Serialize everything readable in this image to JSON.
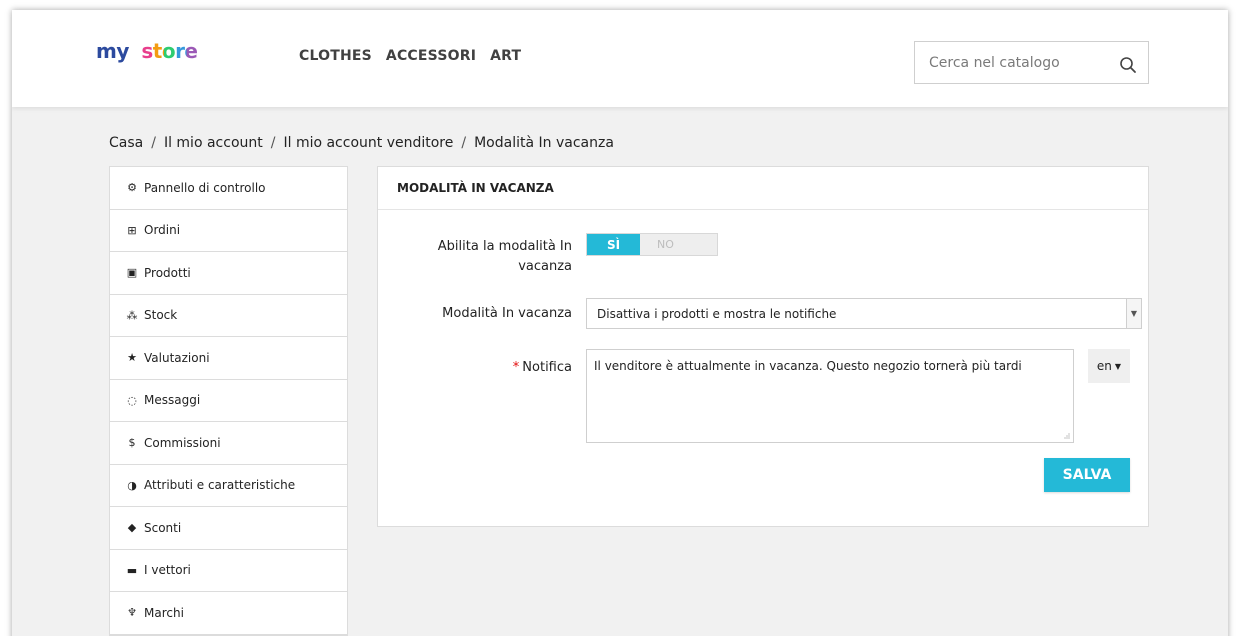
{
  "header": {
    "logo": {
      "part1": "my",
      "part2": "store"
    },
    "nav": [
      "CLOTHES",
      "ACCESSORI",
      "ART"
    ],
    "search_placeholder": "Cerca nel catalogo"
  },
  "breadcrumb": [
    "Casa",
    "Il mio account",
    "Il mio account venditore",
    "Modalità In vacanza"
  ],
  "sidebar": {
    "items": [
      {
        "label": "Pannello di controllo",
        "icon": "dashboard-icon",
        "glyph": "⚙"
      },
      {
        "label": "Ordini",
        "icon": "basket-icon",
        "glyph": "⊞"
      },
      {
        "label": "Prodotti",
        "icon": "gift-icon",
        "glyph": "▣"
      },
      {
        "label": "Stock",
        "icon": "cubes-icon",
        "glyph": "⁂"
      },
      {
        "label": "Valutazioni",
        "icon": "star-icon",
        "glyph": "★"
      },
      {
        "label": "Messaggi",
        "icon": "comment-icon",
        "glyph": "◌"
      },
      {
        "label": "Commissioni",
        "icon": "dollar-icon",
        "glyph": "$"
      },
      {
        "label": "Attributi e caratteristiche",
        "icon": "adjust-icon",
        "glyph": "◑"
      },
      {
        "label": "Sconti",
        "icon": "tag-icon",
        "glyph": "◆"
      },
      {
        "label": "I vettori",
        "icon": "truck-icon",
        "glyph": "▬"
      },
      {
        "label": "Marchi",
        "icon": "trophy-icon",
        "glyph": "♆"
      }
    ]
  },
  "panel": {
    "title": "MODALITÀ IN VACANZA",
    "enable_label": "Abilita la modalità In vacanza",
    "toggle": {
      "on_label": "SÌ",
      "off_label": "NO",
      "value": "on"
    },
    "mode_label": "Modalità In vacanza",
    "mode_value": "Disattiva i prodotti e mostra le notifiche",
    "notification_label": "Notifica",
    "required_mark": "*",
    "notification_value": "Il venditore è attualmente in vacanza. Questo negozio tornerà più tardi",
    "lang": "en",
    "save_label": "SALVA"
  },
  "colors": {
    "accent": "#24b9d7",
    "required": "#e30d0d"
  }
}
